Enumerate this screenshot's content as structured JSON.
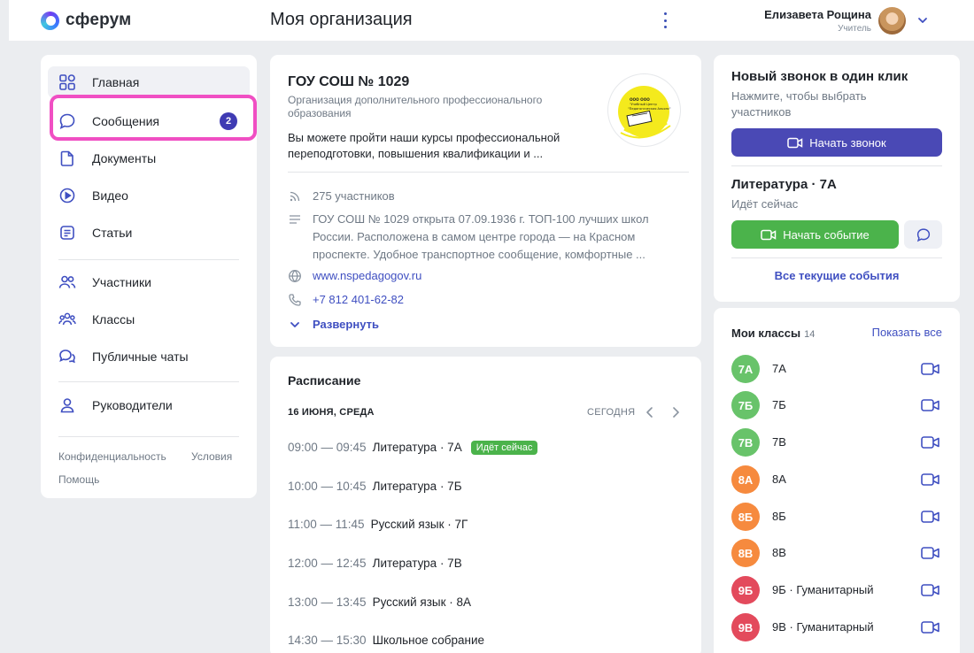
{
  "app": {
    "logo_text": "сферум",
    "page_title": "Моя организация"
  },
  "user": {
    "name": "Елизавета Рощина",
    "role": "Учитель"
  },
  "sidebar": {
    "items": [
      {
        "label": "Главная",
        "icon": "home-grid-icon"
      },
      {
        "label": "Сообщения",
        "icon": "message-icon",
        "badge": "2"
      },
      {
        "label": "Документы",
        "icon": "document-icon"
      },
      {
        "label": "Видео",
        "icon": "video-play-icon"
      },
      {
        "label": "Статьи",
        "icon": "article-icon"
      },
      {
        "label": "Участники",
        "icon": "users-icon"
      },
      {
        "label": "Классы",
        "icon": "classes-icon"
      },
      {
        "label": "Публичные чаты",
        "icon": "public-chats-icon"
      },
      {
        "label": "Руководители",
        "icon": "person-icon"
      }
    ],
    "footer": {
      "privacy": "Конфиденциальность",
      "terms": "Условия",
      "help": "Помощь"
    }
  },
  "organization": {
    "name": "ГОУ СОШ № 1029",
    "type": "Организация дополнительного профессионального образования",
    "description": "Вы можете пройти наши курсы профессиональной переподготовки, повышения квалификации и ...",
    "logo_text": "ООО ООО \"Учебный Центр \"Педагогическая Альянс\"",
    "members": "275 участников",
    "about": "ГОУ СОШ № 1029 открыта 07.09.1936 г. ТОП-100 лучших школ России. Расположена в самом центре города — на Красном проспекте. Удобное транспортное сообщение, комфортные ...",
    "website": "www.nspedagogov.ru",
    "phone": "+7 812 401-62-82",
    "expand": "Развернуть"
  },
  "schedule": {
    "title": "Расписание",
    "date": "16 ИЮНЯ, СРЕДА",
    "today": "СЕГОДНЯ",
    "live_label": "Идёт сейчас",
    "lessons": [
      {
        "time": "09:00 — 09:45",
        "subject": "Литература · 7А",
        "live": true
      },
      {
        "time": "10:00 — 10:45",
        "subject": "Литература · 7Б"
      },
      {
        "time": "11:00 — 11:45",
        "subject": "Русский язык · 7Г"
      },
      {
        "time": "12:00 — 12:45",
        "subject": "Литература · 7В"
      },
      {
        "time": "13:00 — 13:45",
        "subject": "Русский язык · 8А"
      },
      {
        "time": "14:30 — 15:30",
        "subject": "Школьное собрание"
      }
    ]
  },
  "call": {
    "title": "Новый звонок в один клик",
    "subtitle": "Нажмите, чтобы выбрать участников",
    "start_call": "Начать звонок",
    "event_title": "Литература · 7А",
    "event_status": "Идёт сейчас",
    "start_event": "Начать событие",
    "all_events": "Все текущие события"
  },
  "classes": {
    "title": "Мои классы",
    "count": "14",
    "show_all": "Показать все",
    "colors": {
      "green": "#68c36a",
      "orange": "#f68a3e",
      "red": "#e34a5c"
    },
    "items": [
      {
        "avatar": "7А",
        "name": "7А",
        "color": "green"
      },
      {
        "avatar": "7Б",
        "name": "7Б",
        "color": "green"
      },
      {
        "avatar": "7В",
        "name": "7В",
        "color": "green"
      },
      {
        "avatar": "8А",
        "name": "8А",
        "color": "orange"
      },
      {
        "avatar": "8Б",
        "name": "8Б",
        "color": "orange"
      },
      {
        "avatar": "8В",
        "name": "8В",
        "color": "orange"
      },
      {
        "avatar": "9Б",
        "name": "9Б · Гуманитарный",
        "color": "red"
      },
      {
        "avatar": "9В",
        "name": "9В · Гуманитарный",
        "color": "red"
      }
    ]
  },
  "accent": {
    "primary": "#4a49b5",
    "success": "#4bb34b",
    "link": "#3f4fc1",
    "highlight": "#f04fc3"
  }
}
